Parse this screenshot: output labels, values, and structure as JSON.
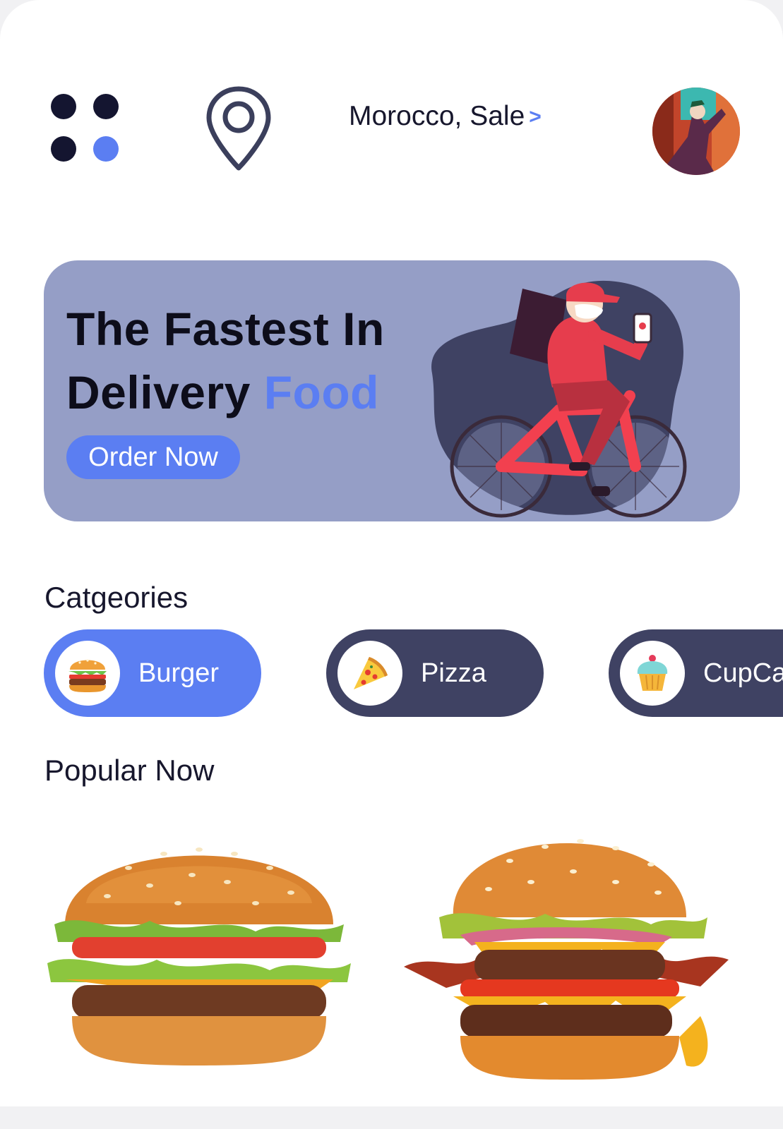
{
  "header": {
    "menu_icon": "grid-dots-icon",
    "location_icon": "map-pin-icon",
    "location_text": "Morocco, Sale",
    "location_arrow": ">",
    "avatar": "user-avatar"
  },
  "banner": {
    "title_line1": "The Fastest In",
    "title_line2_main": "Delivery",
    "title_line2_accent": "Food",
    "button_label": "Order Now"
  },
  "categories": {
    "title": "Catgeories",
    "items": [
      {
        "label": "Burger",
        "icon": "burger-icon",
        "active": true
      },
      {
        "label": "Pizza",
        "icon": "pizza-icon",
        "active": false
      },
      {
        "label": "CupCa",
        "icon": "cupcake-icon",
        "active": false
      }
    ]
  },
  "popular": {
    "title": "Popular Now",
    "items": [
      {
        "image": "cheeseburger-image"
      },
      {
        "image": "bacon-double-burger-image"
      }
    ]
  },
  "colors": {
    "accent": "#5b7ef2",
    "dark": "#3f4263",
    "banner": "#959ec6"
  }
}
